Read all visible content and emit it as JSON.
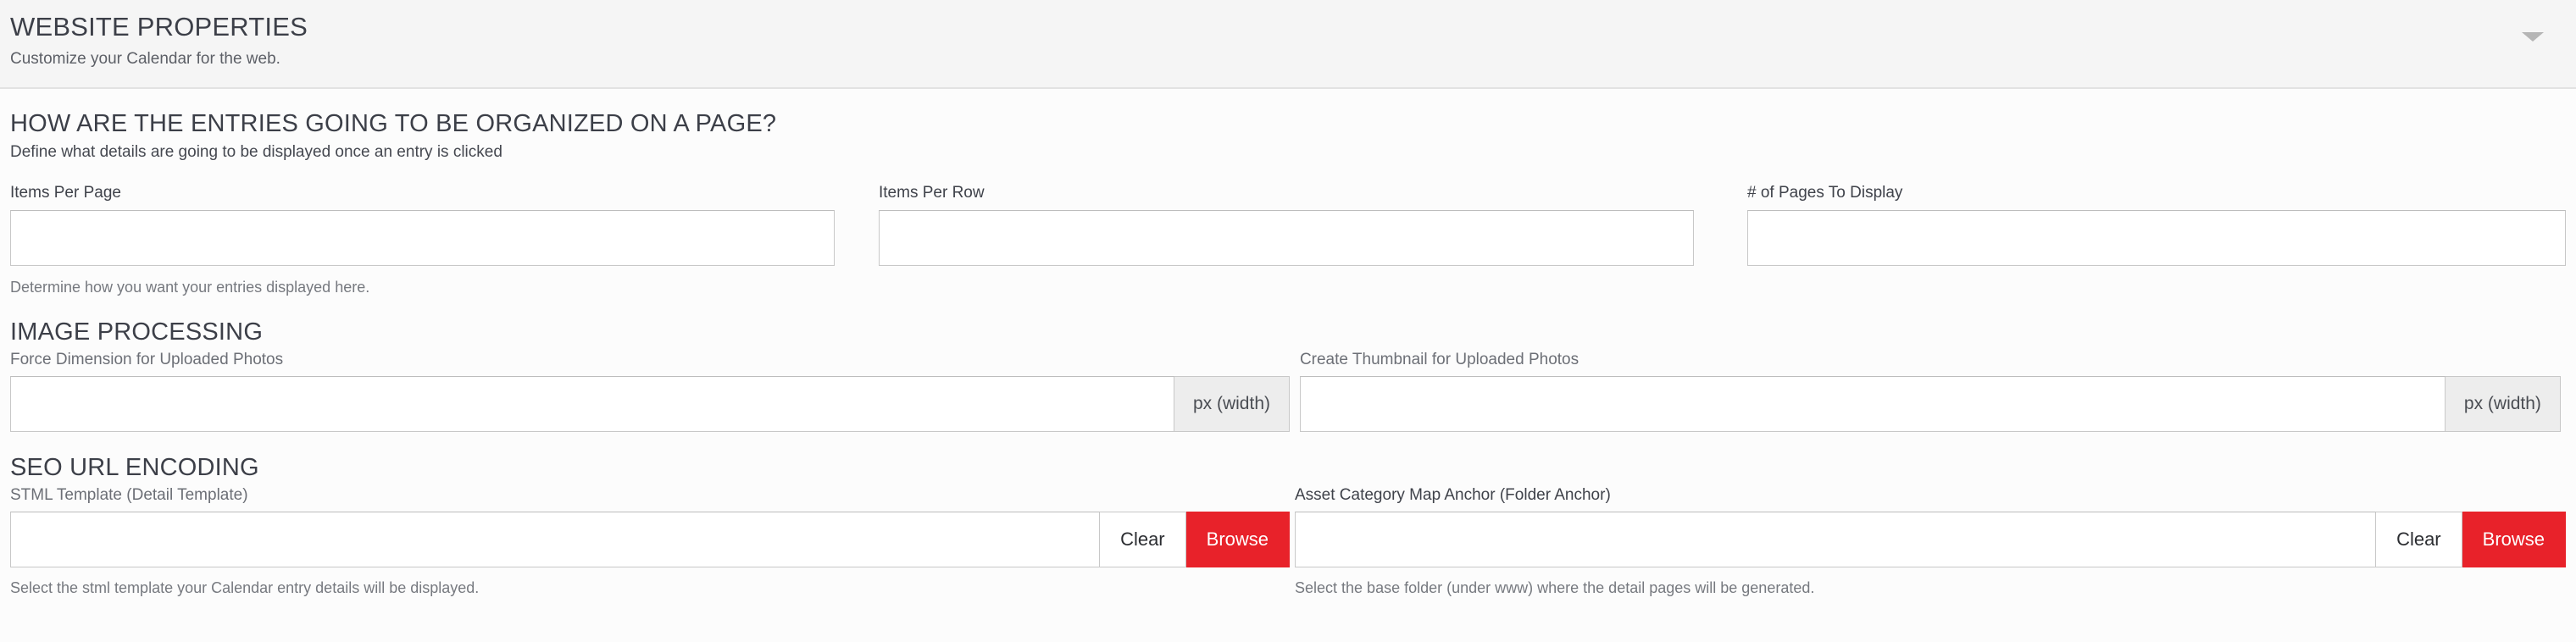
{
  "header": {
    "title": "WEBSITE PROPERTIES",
    "subtitle": "Customize your Calendar for the web.",
    "collapse_icon": "chevron-down-icon"
  },
  "sections": [
    {
      "heading": "HOW ARE THE ENTRIES GOING TO BE ORGANIZED ON A PAGE?",
      "description": "Define what details are going to be displayed once an entry is clicked",
      "fields": [
        {
          "label": "Items Per Page",
          "value": "",
          "placeholder": ""
        },
        {
          "label": "Items Per Row",
          "value": "",
          "placeholder": ""
        },
        {
          "label": "# of Pages To Display",
          "value": "",
          "placeholder": ""
        }
      ],
      "help": "Determine how you want your entries displayed here."
    },
    {
      "heading": "IMAGE PROCESSING",
      "fields": [
        {
          "label": "Force Dimension for Uploaded Photos",
          "value": "",
          "placeholder": "",
          "addon": "px (width)"
        },
        {
          "label": "Create Thumbnail for Uploaded Photos",
          "value": "",
          "placeholder": "",
          "addon": "px (width)"
        }
      ]
    },
    {
      "heading": "SEO URL ENCODING",
      "fields": [
        {
          "label": "STML Template (Detail Template)",
          "value": "",
          "placeholder": "",
          "clear_label": "Clear",
          "browse_label": "Browse",
          "help": "Select the stml template your Calendar entry details will be displayed."
        },
        {
          "label": "Asset Category Map Anchor (Folder Anchor)",
          "value": "",
          "placeholder": "",
          "clear_label": "Clear",
          "browse_label": "Browse",
          "help": "Select the base folder (under www) where the detail pages will be generated."
        }
      ]
    }
  ],
  "colors": {
    "header_background": "#f5f5f5",
    "body_background": "#fcfcfc",
    "browse_button": "#e8222a",
    "addon_background": "#ededed",
    "input_border": "#c8c8c8",
    "heading_text": "#3c3f48"
  }
}
